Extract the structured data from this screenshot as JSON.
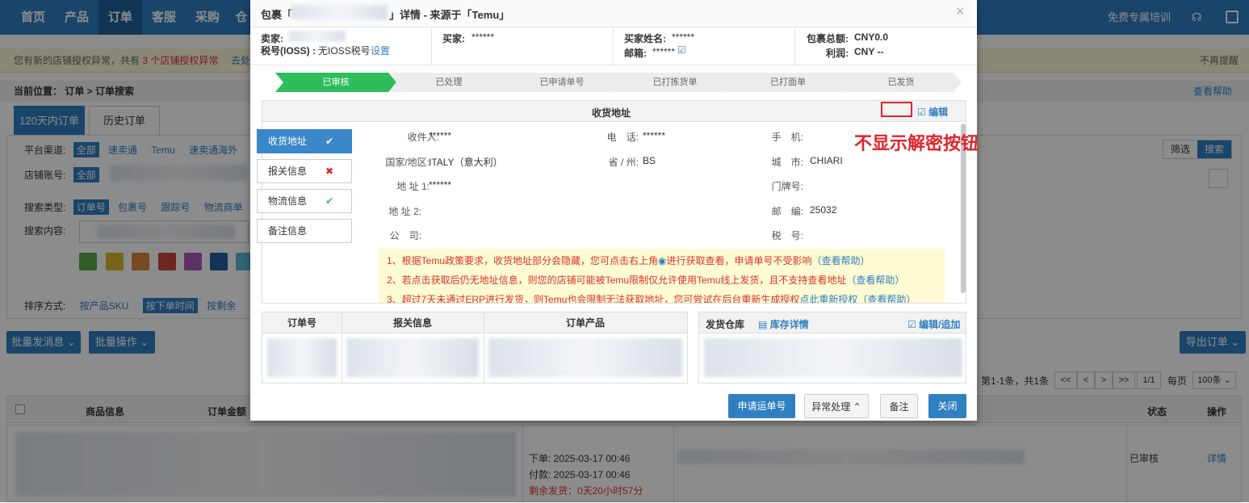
{
  "topnav": {
    "items": [
      "首页",
      "产品",
      "订单",
      "客服",
      "采购",
      "仓"
    ],
    "right_link": "免费专属培训"
  },
  "warning": {
    "text_prefix": "您有新的店铺授权异常，共有",
    "text_count": "3 个店铺授权异常",
    "text_tail": "去处",
    "dismiss": "不再提醒"
  },
  "breadcrumb": {
    "text": "当前位置：  订单 > 订单搜索",
    "help": "查看帮助"
  },
  "tabs": {
    "recent": "120天内订单",
    "history": "历史订单"
  },
  "filters": {
    "platform_label": "平台渠道:",
    "platform_all": "全部",
    "platforms": [
      "速卖通",
      "Temu",
      "速卖通海外"
    ],
    "store_label": "店铺账号:",
    "store_all": "全部",
    "search_type_label": "搜索类型:",
    "search_types": [
      "订单号",
      "包裹号",
      "跟踪号",
      "物流商单"
    ],
    "search_content_label": "搜索内容:",
    "sort_label": "排序方式:",
    "sort_sku": "按产品SKU",
    "sort_time": "按下单时间",
    "sort_more": "按剩余",
    "filter_btn": "筛选",
    "search_btn": "搜索",
    "swatch_colors": [
      "#5aa64a",
      "#d8b62a",
      "#d9883a",
      "#c9463c",
      "#a85cb8",
      "#1f5f9c",
      "#5bb7d6"
    ]
  },
  "actions": {
    "bulk_message": "批量发消息",
    "bulk_ops": "批量操作",
    "export": "导出订单"
  },
  "pagination": {
    "summary": "第1-1条，共1条",
    "first": "<<",
    "prev": "<",
    "next": ">",
    "last": ">>",
    "page": "1/1",
    "per_page_label": "每页",
    "per_page_value": "100条"
  },
  "list": {
    "headers": {
      "product": "商品信息",
      "amount": "订单金额",
      "status": "状态",
      "ops": "操作"
    },
    "row": {
      "order_time": "下单:  2025-03-17 00:46",
      "pay_time": "付款:  2025-03-17 00:46",
      "remaining": "剩余发货：0天20小时57分",
      "status": "已审核",
      "detail": "详情"
    }
  },
  "modal": {
    "title_prefix": "包裹「",
    "title_suffix": "」详情 - 来源于「Temu」",
    "close": "×",
    "info": {
      "seller_label": "卖家:",
      "tax_label": "税号(IOSS) :",
      "tax_value": "无IOSS税号",
      "tax_set": "设置",
      "buyer_label": "买家:",
      "buyer_value": "******",
      "buyer_name_label": "买家姓名:",
      "buyer_name_value": "******",
      "email_label": "邮箱:",
      "email_value": "******",
      "total_label": "包裹总额:",
      "total_value": "CNY0.0",
      "profit_label": "利润:",
      "profit_value": "CNY --"
    },
    "steps": [
      "已审核",
      "已处理",
      "已申请单号",
      "已打拣货单",
      "已打面单",
      "已发货"
    ],
    "side_tabs": [
      {
        "label": "收货地址",
        "mark": "✔"
      },
      {
        "label": "报关信息",
        "mark": "✖"
      },
      {
        "label": "物流信息",
        "mark": "✔"
      },
      {
        "label": "备注信息",
        "mark": ""
      }
    ],
    "address": {
      "section_title": "收货地址",
      "edit": "编辑",
      "recipient_label": "收件人:",
      "recipient": "******",
      "phone_label": "电　话:",
      "phone": "******",
      "mobile_label": "手　机:",
      "country_label": "国家/地区:",
      "country": "ITALY（意大利）",
      "province_label": "省 / 州:",
      "province": "BS",
      "city_label": "城　市:",
      "city": "CHIARI",
      "addr1_label": "地 址 1:",
      "addr1": "******",
      "door_label": "门牌号:",
      "addr2_label": "地 址 2:",
      "zip_label": "邮　编:",
      "zip": "25032",
      "company_label": "公　司:",
      "taxno_label": "税　号:"
    },
    "annotation": "不显示解密按钮",
    "notices": [
      {
        "text": "1、根据Temu政策要求，收货地址部分会隐藏，您可点击右上角",
        "tail": "进行获取查看，申请单号不受影响",
        "help": "（查看帮助）"
      },
      {
        "text": "2、若点击获取后仍无地址信息，则您的店铺可能被Temu限制仅允许使用Temu线上发货，且不支持查看地址",
        "tail": "",
        "help": "（查看帮助）"
      },
      {
        "text": "3、超过7天未通过ERP进行发货，则Temu也会限制无法获取地址，您可尝试在后台重新生成授权",
        "tail": "点此重新授权",
        "help": "（查看帮助）"
      }
    ],
    "order_table": {
      "headers": [
        "订单号",
        "报关信息",
        "订单产品"
      ]
    },
    "warehouse": {
      "label": "发货仓库",
      "stock": "库存详情",
      "edit": "编辑/追加"
    },
    "buttons": {
      "apply": "申请运单号",
      "exception": "异常处理",
      "remark": "备注",
      "close": "关闭"
    }
  }
}
